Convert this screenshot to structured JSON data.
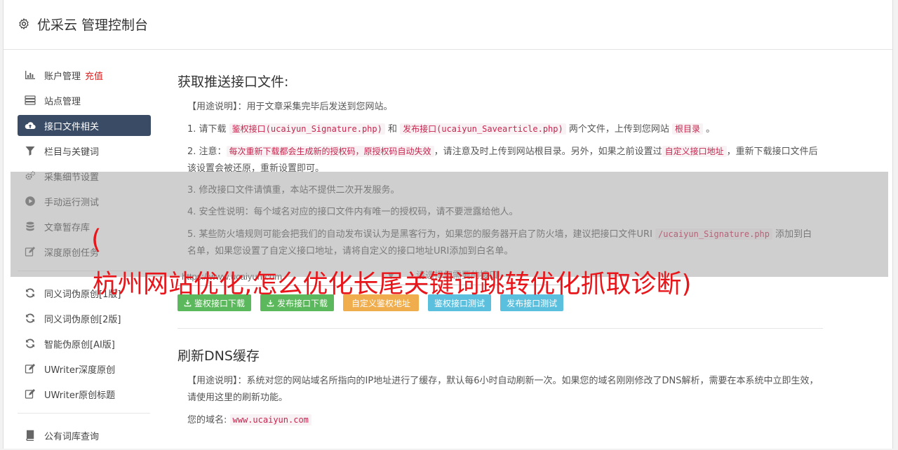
{
  "app": {
    "title": "优采云 管理控制台"
  },
  "sidebar": {
    "group1": [
      {
        "label": "账户管理",
        "extra": "充值",
        "icon": "bar-chart-icon"
      },
      {
        "label": "站点管理",
        "icon": "server-icon"
      },
      {
        "label": "接口文件相关",
        "icon": "cloud-upload-icon",
        "active": true
      },
      {
        "label": "栏目与关键词",
        "icon": "filter-icon"
      },
      {
        "label": "采集细节设置",
        "icon": "cogs-icon"
      },
      {
        "label": "手动运行测试",
        "icon": "play-circle-icon"
      },
      {
        "label": "文章暂存库",
        "icon": "database-icon"
      },
      {
        "label": "深度原创任务",
        "icon": "edit-icon"
      }
    ],
    "group2": [
      {
        "label": "同义词伪原创[1版]",
        "icon": "refresh-icon"
      },
      {
        "label": "同义词伪原创[2版]",
        "icon": "refresh-icon"
      },
      {
        "label": "智能伪原创[AI版]",
        "icon": "refresh-icon"
      },
      {
        "label": "UWriter深度原创",
        "icon": "edit-icon"
      },
      {
        "label": "UWriter原创标题",
        "icon": "edit-icon"
      }
    ],
    "group3": [
      {
        "label": "公有词库查询",
        "icon": "book-icon"
      }
    ]
  },
  "section1": {
    "title": "获取推送接口文件:",
    "usage_label": "【用途说明】：",
    "usage_text": "用于文章采集完毕后发送到您网站。",
    "step1": {
      "a": "1. 请下载 ",
      "code1": "鉴权接口(ucaiyun_Signature.php)",
      "b": " 和 ",
      "code2": "发布接口(ucaiyun_Savearticle.php)",
      "c": " 两个文件，上传到您网站 ",
      "code3": "根目录",
      "d": " 。"
    },
    "step2": {
      "a": "2. 注意：",
      "code1": "每次重新下载都会生成新的授权码，原授权码自动失效",
      "b": "，请注意及时上传到网站根目录。另外，如果之前设置过",
      "code2": "自定义接口地址",
      "c": "，重新下载接口文件后该设置会被还原，重新设置即可。"
    },
    "step3": "3. 修改接口文件请慎重，本站不提供二次开发服务。",
    "step4": "4. 安全性说明：每个域名对应的接口文件内有唯一的授权码，请不要泄露给他人。",
    "step5": {
      "a": "5. 某些防火墙规则可能会把我们的自动发布误认为是黑客行为，如果您的服务器开启了防火墙，建议把接口文件URI ",
      "code1": "/ucaiyun_Signature.php",
      "b": " 添加到白名单，如果您设置了自定义接口地址，请将自定义的接口地址URI添加到白名单。"
    },
    "url_value": "https://www.ucaiyun.com",
    "select_value": "请选择您需要的接口",
    "buttons": {
      "sig_download": "鉴权接口下载",
      "pub_download": "发布接口下载",
      "custom_auth": "自定义鉴权地址",
      "sig_test": "鉴权接口测试",
      "pub_test": "发布接口测试"
    }
  },
  "section2": {
    "title": "刷新DNS缓存",
    "usage_label": "【用途说明】：",
    "usage_text": "系统对您的网站域名所指向的IP地址进行了缓存，默认每6小时自动刷新一次。如果您的域名刚刚修改了DNS解析，需要在本系统中立即生效，请使用这里的刷新功能。",
    "domain_label": "您的域名:",
    "domain_value": "www.ucaiyun.com"
  },
  "overlay": {
    "line1": "(",
    "line2": "杭州网站优化,怎么优化长尾关键词跳转优化抓取诊断)"
  },
  "colors": {
    "sidebar_active": "#3a4b66",
    "btn_green": "#5cb85c",
    "btn_orange": "#f0ad4e",
    "btn_blue": "#5bc0de",
    "overlay_text": "#e8161a",
    "code_text": "#c7254e"
  }
}
